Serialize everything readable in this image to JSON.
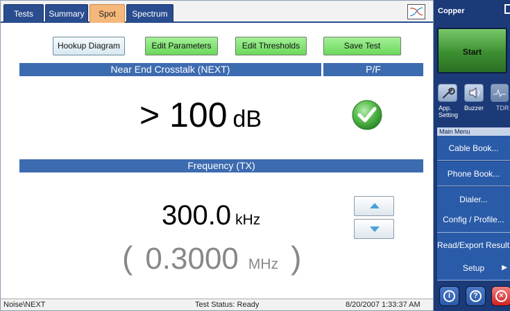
{
  "tabs": [
    {
      "label": "Tests"
    },
    {
      "label": "Summary"
    },
    {
      "label": "Spot"
    },
    {
      "label": "Spectrum"
    }
  ],
  "active_tab": "Spot",
  "toolbar": {
    "hookup_label": "Hookup Diagram",
    "edit_params_label": "Edit Parameters",
    "edit_thresholds_label": "Edit Thresholds",
    "save_label": "Save Test"
  },
  "next": {
    "header": "Near End Crosstalk (NEXT)",
    "pf_header": "P/F",
    "value": "> 100",
    "unit": "dB",
    "result": "pass"
  },
  "frequency": {
    "header": "Frequency (TX)",
    "khz_value": "300.0",
    "khz_unit": "kHz",
    "mhz_open": "(",
    "mhz_value": "0.3000",
    "mhz_unit": "MHz",
    "mhz_close": ")"
  },
  "status": {
    "left": "Noise\\NEXT",
    "mid": "Test Status: Ready",
    "right": "8/20/2007 1:33:37 AM"
  },
  "panel": {
    "title": "Copper",
    "start_label": "Start",
    "tools": {
      "app_label": "App. Setting",
      "buzzer_label": "Buzzer",
      "tdr_label": "TDR"
    },
    "main_menu_label": "Main Menu",
    "menu_items": [
      {
        "label": "Cable Book..."
      },
      {
        "label": "Phone Book..."
      },
      {
        "label": "Dialer..."
      },
      {
        "label": "Config / Profile..."
      },
      {
        "label": "Read/Export Result..."
      },
      {
        "label": "Setup"
      }
    ]
  },
  "colors": {
    "tab_active": "#f5b87a",
    "tab_inactive": "#2a4d8f",
    "section_header": "#3d6bb0",
    "green_button": "#6ad85a",
    "panel_bg": "#1c3a78",
    "pass_green": "#4cb848"
  }
}
